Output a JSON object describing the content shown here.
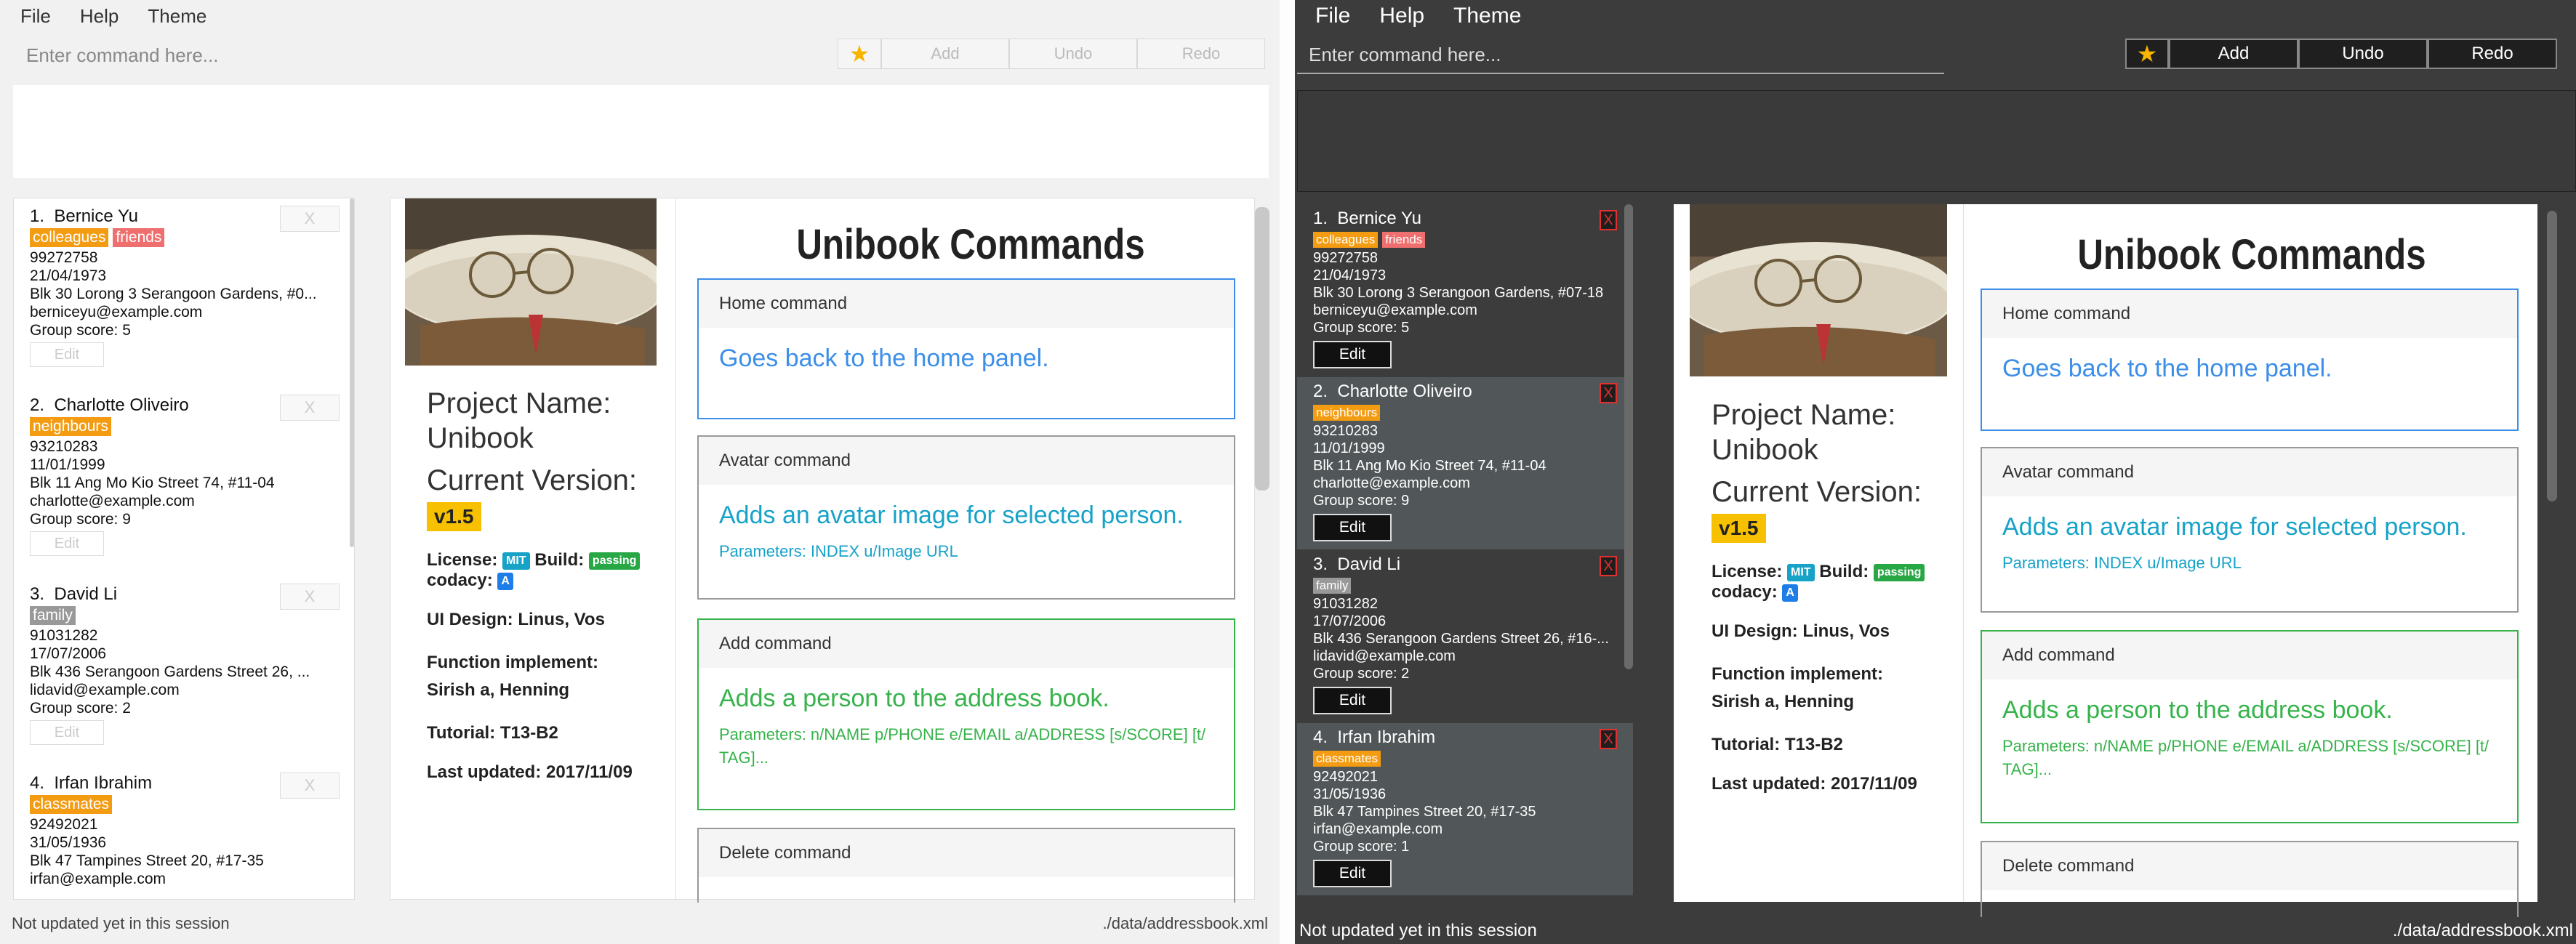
{
  "menu": [
    "File",
    "Help",
    "Theme"
  ],
  "command_placeholder": "Enter command here...",
  "toolbar": {
    "add": "Add",
    "undo": "Undo",
    "redo": "Redo"
  },
  "persons": [
    {
      "index": "1.",
      "name": "Bernice Yu",
      "tags": [
        {
          "label": "colleagues",
          "color": "#f39c12"
        },
        {
          "label": "friends",
          "color": "#ef6f6f"
        }
      ],
      "phone": "99272758",
      "birthday": "21/04/1973",
      "address": "Blk 30 Lorong 3 Serangoon Gardens, #07-18",
      "address_light": "Blk 30 Lorong 3 Serangoon Gardens, #0...",
      "email": "berniceyu@example.com",
      "score": "Group score: 5"
    },
    {
      "index": "2.",
      "name": "Charlotte Oliveiro",
      "tags": [
        {
          "label": "neighbours",
          "color": "#f39c12"
        }
      ],
      "phone": "93210283",
      "birthday": "11/01/1999",
      "address": "Blk 11 Ang Mo Kio Street 74, #11-04",
      "address_light": "Blk 11 Ang Mo Kio Street 74, #11-04",
      "email": "charlotte@example.com",
      "score": "Group score: 9"
    },
    {
      "index": "3.",
      "name": "David Li",
      "tags": [
        {
          "label": "family",
          "color": "#999999"
        }
      ],
      "phone": "91031282",
      "birthday": "17/07/2006",
      "address": "Blk 436 Serangoon Gardens Street 26, #16-...",
      "address_light": "Blk 436 Serangoon Gardens Street 26, ...",
      "email": "lidavid@example.com",
      "score": "Group score: 2"
    },
    {
      "index": "4.",
      "name": "Irfan Ibrahim",
      "tags": [
        {
          "label": "classmates",
          "color": "#f39c12"
        }
      ],
      "phone": "92492021",
      "birthday": "31/05/1936",
      "address": "Blk 47 Tampines Street 20, #17-35",
      "address_light": "Blk 47 Tampines Street 20, #17-35",
      "email": "irfan@example.com",
      "score": "Group score: 1"
    }
  ],
  "delete_label": "X",
  "edit_label": "Edit",
  "info": {
    "project_name": "Project Name: Unibook",
    "current_version_label": "Current Version:",
    "version": "v1.5",
    "license_label": "License:",
    "license_badge": "MIT",
    "build_label": "Build:",
    "build_badge": "passing",
    "codacy_label": "codacy:",
    "codacy_badge": "A",
    "ui_design": "UI Design: Linus, Vos",
    "function_implement": "Function implement: Sirish a, Henning",
    "tutorial": "Tutorial: T13-B2",
    "last_updated": "Last updated: 2017/11/09"
  },
  "commands_title": "Unibook Commands",
  "commands": [
    {
      "title": "Home command",
      "desc": "Goes back to the home panel.",
      "params": "",
      "color": "#3c8ee8"
    },
    {
      "title": "Avatar command",
      "desc": "Adds an avatar image for selected person.",
      "params": "Parameters: INDEX u/Image URL",
      "color": "#17a2c8"
    },
    {
      "title": "Add command",
      "desc": "Adds a person to the address book.",
      "params": "Parameters: n/NAME p/PHONE e/EMAIL a/ADDRESS [s/SCORE] [t/ TAG]...",
      "color": "#36b34a"
    },
    {
      "title": "Delete command",
      "desc": "",
      "params": "",
      "color": "#555555"
    }
  ],
  "status": {
    "left": "Not updated yet in this session",
    "right": "./data/addressbook.xml"
  }
}
